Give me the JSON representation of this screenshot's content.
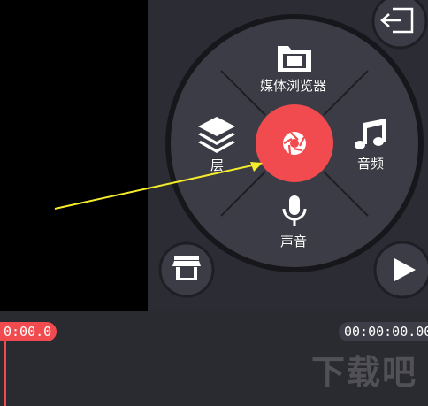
{
  "colors": {
    "record_red": "#f14b4f",
    "wheel_bg": "#3b3c45",
    "wheel_border": "#17171b",
    "arrow": "#f5ec2b",
    "playhead": "#f14b4f"
  },
  "wheel": {
    "top_label": "媒体浏览器",
    "left_label": "层",
    "right_label": "音频",
    "bottom_label": "声音",
    "center_icon": "camera-aperture-icon"
  },
  "buttons": {
    "exit_icon": "exit-icon",
    "store_icon": "store-icon",
    "play_icon": "play-icon"
  },
  "timeline": {
    "current_time": "0:00.0",
    "total_time": "00:00:00.00"
  },
  "watermark": "下载吧"
}
